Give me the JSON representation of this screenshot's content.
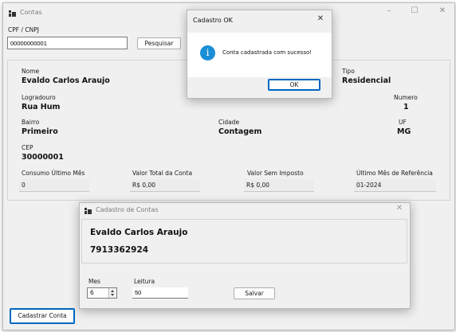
{
  "main_window": {
    "title": "Contas",
    "cpf_label": "CPF / CNPJ",
    "cpf_value": "00000000001",
    "search_button": "Pesquisar",
    "fields": {
      "nome_label": "Nome",
      "nome_value": "Evaldo Carlos Araujo",
      "tipo_label": "Tipo",
      "tipo_value": "Residencial",
      "logradouro_label": "Logradouro",
      "logradouro_value": "Rua Hum",
      "numero_label": "Numero",
      "numero_value": "1",
      "bairro_label": "Bairro",
      "bairro_value": "Primeiro",
      "cidade_label": "Cidade",
      "cidade_value": "Contagem",
      "uf_label": "UF",
      "uf_value": "MG",
      "cep_label": "CEP",
      "cep_value": "30000001"
    },
    "summary": {
      "consumo_label": "Consumo Último Mês",
      "consumo_value": "0",
      "valor_total_label": "Valor Total da Conta",
      "valor_total_value": "R$ 0,00",
      "valor_sem_imposto_label": "Valor Sem Imposto",
      "valor_sem_imposto_value": "R$ 0,00",
      "ultimo_mes_label": "Último Mês de Referência",
      "ultimo_mes_value": "01-2024"
    },
    "cadastrar_button": "Cadastrar Conta",
    "controls": {
      "minimize": "–",
      "maximize": "☐",
      "close": "✕"
    }
  },
  "message_box": {
    "title": "Cadastro OK",
    "message": "Conta cadastrada com sucesso!",
    "icon_glyph": "i",
    "ok_button": "OK",
    "close": "✕"
  },
  "register_dialog": {
    "title": "Cadastro de Contas",
    "name": "Evaldo Carlos Araujo",
    "number": "7913362924",
    "mes_label": "Mes",
    "mes_value": "6",
    "leitura_label": "Leitura",
    "leitura_value": "50",
    "save_button": "Salvar",
    "close": "✕"
  },
  "colors": {
    "accent": "#0067c0",
    "info_icon": "#1a8fd6"
  }
}
